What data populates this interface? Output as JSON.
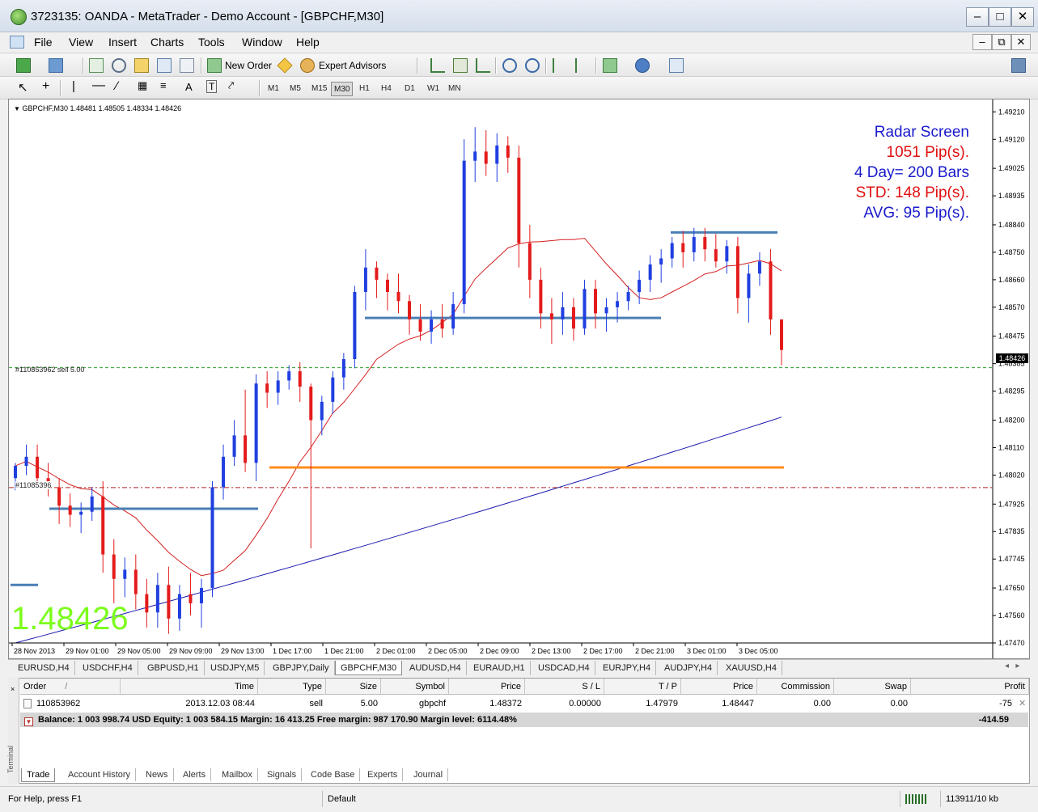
{
  "window": {
    "title": "3723135: OANDA - MetaTrader - Demo Account - [GBPCHF,M30]"
  },
  "menu": [
    "File",
    "View",
    "Insert",
    "Charts",
    "Tools",
    "Window",
    "Help"
  ],
  "toolbar": {
    "new_order": "New Order",
    "expert_advisors": "Expert Advisors"
  },
  "timeframes": [
    "M1",
    "M5",
    "M15",
    "M30",
    "H1",
    "H4",
    "D1",
    "W1",
    "MN"
  ],
  "active_timeframe": "M30",
  "chart": {
    "header": "GBPCHF,M30  1.48481 1.48505 1.48334 1.48426",
    "big_price": "1.48426",
    "current_price_label": "1.48426",
    "radar": [
      "Radar Screen",
      "1051 Pip(s).",
      "4 Day= 200 Bars",
      "STD: 148 Pip(s).",
      "AVG: 95 Pip(s)."
    ],
    "radar_colors": [
      "#1a1acc",
      "#e01010",
      "#1a1acc",
      "#e01010",
      "#1a1acc"
    ],
    "order_label": "#110853962 sell 5.00",
    "order_label_2": "#11085396",
    "colors": {
      "bull": "#1f3fe0",
      "bear": "#e41b1b",
      "ma_fast": "#d42020",
      "ma_slow": "#1a1ab0",
      "level": "#4a7fb5",
      "orange": "#ff8c1a"
    }
  },
  "chart_data": {
    "type": "candlestick",
    "symbol": "GBPCHF",
    "timeframe": "M30",
    "ylim": [
      1.4747,
      1.4924
    ],
    "y_ticks": [
      "1.49210",
      "1.49120",
      "1.49025",
      "1.48935",
      "1.48840",
      "1.48750",
      "1.48660",
      "1.48570",
      "1.48475",
      "1.48385",
      "1.48295",
      "1.48200",
      "1.48110",
      "1.48020",
      "1.47925",
      "1.47835",
      "1.47745",
      "1.47650",
      "1.47560",
      "1.47470"
    ],
    "x_ticks": [
      "28 Nov 2013",
      "29 Nov 01:00",
      "29 Nov 05:00",
      "29 Nov 09:00",
      "29 Nov 13:00",
      "1 Dec 17:00",
      "1 Dec 21:00",
      "2 Dec 01:00",
      "2 Dec 05:00",
      "2 Dec 09:00",
      "2 Dec 13:00",
      "2 Dec 17:00",
      "2 Dec 21:00",
      "3 Dec 01:00",
      "3 Dec 05:00"
    ],
    "sell_order_price": 1.48372,
    "stop_level_price": 1.47979,
    "orange_level": 1.48045,
    "horizontal_levels": [
      1.4791,
      1.48535,
      1.48815,
      1.4766
    ],
    "candles": [
      [
        1.4801,
        1.4806,
        1.4797,
        1.4805
      ],
      [
        1.4805,
        1.4812,
        1.4802,
        1.4808
      ],
      [
        1.4808,
        1.4812,
        1.4799,
        1.4801
      ],
      [
        1.4801,
        1.4806,
        1.4795,
        1.4798
      ],
      [
        1.4798,
        1.4801,
        1.4786,
        1.4792
      ],
      [
        1.4792,
        1.4796,
        1.4785,
        1.4789
      ],
      [
        1.4789,
        1.4793,
        1.4783,
        1.479
      ],
      [
        1.479,
        1.4798,
        1.4787,
        1.4795
      ],
      [
        1.4795,
        1.48,
        1.477,
        1.4776
      ],
      [
        1.4776,
        1.4781,
        1.476,
        1.4768
      ],
      [
        1.4768,
        1.4775,
        1.4762,
        1.4771
      ],
      [
        1.4771,
        1.4776,
        1.4758,
        1.4763
      ],
      [
        1.4763,
        1.4768,
        1.4752,
        1.4757
      ],
      [
        1.4757,
        1.477,
        1.4752,
        1.4766
      ],
      [
        1.4766,
        1.4772,
        1.475,
        1.4755
      ],
      [
        1.4755,
        1.4766,
        1.4751,
        1.4763
      ],
      [
        1.4763,
        1.477,
        1.4756,
        1.476
      ],
      [
        1.476,
        1.4768,
        1.4752,
        1.4765
      ],
      [
        1.4765,
        1.48,
        1.4762,
        1.4798
      ],
      [
        1.4798,
        1.4812,
        1.4794,
        1.4808
      ],
      [
        1.4808,
        1.482,
        1.4805,
        1.4815
      ],
      [
        1.4815,
        1.483,
        1.4803,
        1.4806
      ],
      [
        1.4806,
        1.4835,
        1.48,
        1.4832
      ],
      [
        1.4832,
        1.4836,
        1.4824,
        1.4829
      ],
      [
        1.4829,
        1.4836,
        1.4825,
        1.4833
      ],
      [
        1.4833,
        1.4838,
        1.483,
        1.4836
      ],
      [
        1.4836,
        1.4839,
        1.4826,
        1.4831
      ],
      [
        1.4831,
        1.4832,
        1.4778,
        1.482
      ],
      [
        1.482,
        1.4828,
        1.4815,
        1.4826
      ],
      [
        1.4826,
        1.4836,
        1.4822,
        1.4834
      ],
      [
        1.4834,
        1.4842,
        1.483,
        1.484
      ],
      [
        1.484,
        1.4864,
        1.4837,
        1.4862
      ],
      [
        1.4862,
        1.4876,
        1.4856,
        1.487
      ],
      [
        1.487,
        1.4872,
        1.486,
        1.4866
      ],
      [
        1.4866,
        1.4868,
        1.4856,
        1.4862
      ],
      [
        1.4862,
        1.4868,
        1.4855,
        1.4859
      ],
      [
        1.4859,
        1.4861,
        1.4848,
        1.4853
      ],
      [
        1.4853,
        1.4858,
        1.4846,
        1.4849
      ],
      [
        1.4849,
        1.4856,
        1.4845,
        1.4853
      ],
      [
        1.4853,
        1.4858,
        1.4847,
        1.485
      ],
      [
        1.485,
        1.4862,
        1.4848,
        1.4858
      ],
      [
        1.4858,
        1.4912,
        1.4855,
        1.4905
      ],
      [
        1.4905,
        1.4916,
        1.4898,
        1.4908
      ],
      [
        1.4908,
        1.4915,
        1.49,
        1.4904
      ],
      [
        1.4904,
        1.4914,
        1.4898,
        1.491
      ],
      [
        1.491,
        1.4913,
        1.4901,
        1.4906
      ],
      [
        1.4906,
        1.491,
        1.487,
        1.4878
      ],
      [
        1.4878,
        1.4884,
        1.486,
        1.4866
      ],
      [
        1.4866,
        1.487,
        1.485,
        1.4855
      ],
      [
        1.4855,
        1.486,
        1.4845,
        1.4853
      ],
      [
        1.4853,
        1.4862,
        1.4848,
        1.4857
      ],
      [
        1.4857,
        1.486,
        1.4846,
        1.485
      ],
      [
        1.485,
        1.4866,
        1.4848,
        1.4863
      ],
      [
        1.4863,
        1.4866,
        1.485,
        1.4855
      ],
      [
        1.4855,
        1.486,
        1.4849,
        1.4857
      ],
      [
        1.4857,
        1.4862,
        1.4852,
        1.4859
      ],
      [
        1.4859,
        1.4864,
        1.4856,
        1.4862
      ],
      [
        1.4862,
        1.4869,
        1.4858,
        1.4866
      ],
      [
        1.4866,
        1.4874,
        1.4862,
        1.4871
      ],
      [
        1.4871,
        1.4876,
        1.4865,
        1.4873
      ],
      [
        1.4873,
        1.488,
        1.487,
        1.4878
      ],
      [
        1.4878,
        1.4882,
        1.487,
        1.4875
      ],
      [
        1.4875,
        1.4883,
        1.4872,
        1.488
      ],
      [
        1.488,
        1.4883,
        1.4872,
        1.4876
      ],
      [
        1.4876,
        1.4881,
        1.487,
        1.4872
      ],
      [
        1.4872,
        1.4879,
        1.4868,
        1.4877
      ],
      [
        1.4877,
        1.488,
        1.4855,
        1.486
      ],
      [
        1.486,
        1.4871,
        1.4852,
        1.4868
      ],
      [
        1.4868,
        1.4875,
        1.4864,
        1.4872
      ],
      [
        1.4872,
        1.4876,
        1.4848,
        1.4853
      ],
      [
        1.4853,
        1.485,
        1.4838,
        1.4843
      ]
    ]
  },
  "symbol_tabs": [
    "EURUSD,H4",
    "USDCHF,H4",
    "GBPUSD,H1",
    "USDJPY,M5",
    "GBPJPY,Daily",
    "GBPCHF,M30",
    "AUDUSD,H4",
    "EURAUD,H1",
    "USDCAD,H4",
    "EURJPY,H4",
    "AUDJPY,H4",
    "XAUUSD,H4"
  ],
  "active_symbol_tab": "GBPCHF,M30",
  "terminal": {
    "strip_label": "Terminal",
    "columns": [
      "Order",
      "/",
      "Time",
      "Type",
      "Size",
      "Symbol",
      "Price",
      "S / L",
      "T / P",
      "Price",
      "Commission",
      "Swap",
      "Profit"
    ],
    "row": {
      "order": "110853962",
      "time": "2013.12.03 08:44",
      "type": "sell",
      "size": "5.00",
      "symbol": "gbpchf",
      "price": "1.48372",
      "sl": "0.00000",
      "tp": "1.47979",
      "current": "1.48447",
      "commission": "0.00",
      "swap": "0.00",
      "profit": "-75"
    },
    "balance_text": "Balance: 1 003 998.74 USD  Equity: 1 003 584.15  Margin: 16 413.25  Free margin: 987 170.90  Margin level: 6114.48%",
    "balance_profit": "-414.59",
    "tabs": [
      "Trade",
      "Account History",
      "News",
      "Alerts",
      "Mailbox",
      "Signals",
      "Code Base",
      "Experts",
      "Journal"
    ],
    "active_tab": "Trade"
  },
  "status": {
    "help": "For Help, press F1",
    "profile": "Default",
    "traffic": "113911/10 kb"
  }
}
